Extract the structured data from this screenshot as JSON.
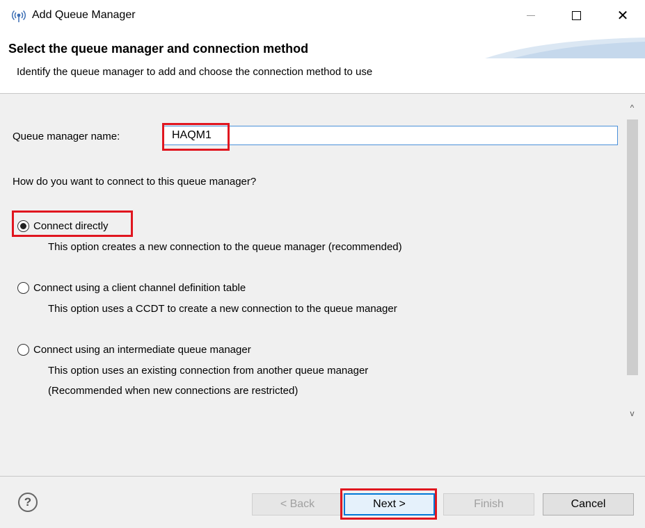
{
  "window": {
    "title": "Add Queue Manager",
    "close_glyph": "✕"
  },
  "banner": {
    "title": "Select the queue manager and connection method",
    "description": "Identify the queue manager to add and choose the connection method to use"
  },
  "form": {
    "qm_label": "Queue manager name:",
    "qm_value": "HAQM1",
    "question": "How do you want to connect to this queue manager?",
    "options": [
      {
        "label": "Connect directly",
        "selected": true,
        "desc": [
          "This option creates a new connection to the queue manager (recommended)"
        ]
      },
      {
        "label": "Connect using a client channel definition table",
        "selected": false,
        "desc": [
          "This option uses a CCDT to create a new connection to the queue manager"
        ]
      },
      {
        "label": "Connect using an intermediate queue manager",
        "selected": false,
        "desc": [
          "This option uses an existing connection from another queue manager",
          "(Recommended when new connections are restricted)"
        ]
      }
    ]
  },
  "buttons": {
    "help": "?",
    "back": "< Back",
    "next": "Next >",
    "finish": "Finish",
    "cancel": "Cancel"
  },
  "scroll": {
    "up_glyph": "^",
    "down_glyph": "v"
  },
  "colors": {
    "highlight": "#e0161f",
    "focus_border": "#4a90d9"
  }
}
